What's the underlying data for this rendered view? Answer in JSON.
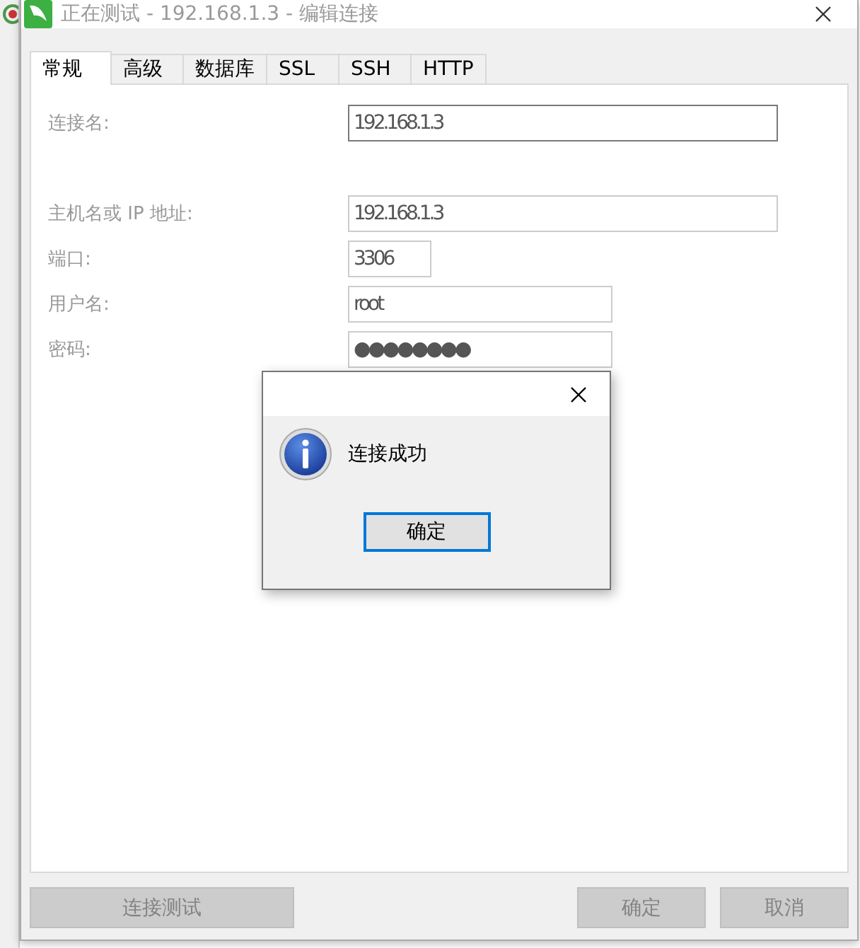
{
  "window": {
    "title": "正在测试 - 192.168.1.3 - 编辑连接",
    "active": false
  },
  "tabs": [
    {
      "label": "常规",
      "selected": true
    },
    {
      "label": "高级",
      "selected": false
    },
    {
      "label": "数据库",
      "selected": false
    },
    {
      "label": "SSL",
      "selected": false
    },
    {
      "label": "SSH",
      "selected": false
    },
    {
      "label": "HTTP",
      "selected": false
    }
  ],
  "form": [
    {
      "kind": "text",
      "label": "连接名:",
      "value": "192.168.1.3",
      "focused": true
    },
    {
      "kind": "gap"
    },
    {
      "kind": "text",
      "label": "主机名或 IP 地址:",
      "value": "192.168.1.3",
      "focused": false
    },
    {
      "kind": "text",
      "label": "端口:",
      "value": "3306",
      "focused": false
    },
    {
      "kind": "text",
      "label": "用户名:",
      "value": "root",
      "focused": false
    },
    {
      "kind": "password",
      "label": "密码:",
      "value": "●●●●●●●●",
      "focused": false
    }
  ],
  "message_box": {
    "message": "连接成功",
    "button": "确定"
  },
  "buttons": [
    {
      "label": "连接测试",
      "disabled": true
    },
    {
      "label": "确定",
      "disabled": true
    },
    {
      "label": "取消",
      "disabled": true
    }
  ]
}
